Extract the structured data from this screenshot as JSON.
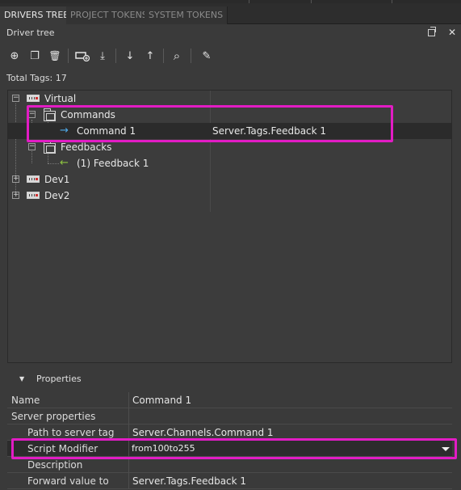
{
  "tabs": [
    {
      "label": "DRIVERS TREE",
      "active": true
    },
    {
      "label": "PROJECT TOKENS",
      "active": false
    },
    {
      "label": "SYSTEM TOKENS",
      "active": false
    }
  ],
  "panel": {
    "title": "Driver tree",
    "pin_icon": "pin-icon",
    "close_glyph": "✕"
  },
  "toolbar": {
    "icons": [
      "add-circle-icon",
      "copy-icon",
      "delete-icon",
      "add-device-icon",
      "import-icon",
      "move-down-icon",
      "move-up-icon",
      "search-icon",
      "clean-icon"
    ],
    "glyphs": {
      "add": "⊕",
      "copy": "❐",
      "delete": "🗑",
      "device": "▭",
      "import": "⤓",
      "down": "↓",
      "up": "↑",
      "search": "⌕",
      "clean": "✎"
    }
  },
  "total_tags": "Total Tags: 17",
  "tree": {
    "rows": [
      {
        "label": "Virtual",
        "value": "",
        "expander": "−"
      },
      {
        "label": "Commands",
        "value": "",
        "expander": "−"
      },
      {
        "label": "Command 1",
        "value": "Server.Tags.Feedback 1",
        "arrow": "→"
      },
      {
        "label": "Feedbacks",
        "value": "",
        "expander": "−"
      },
      {
        "label": "(1) Feedback 1",
        "value": "",
        "arrow": "←"
      },
      {
        "label": "Dev1",
        "value": "",
        "expander": "+"
      },
      {
        "label": "Dev2",
        "value": "",
        "expander": "+"
      }
    ]
  },
  "properties": {
    "header": "Properties",
    "chevron": "▼",
    "rows": [
      {
        "name": "Name",
        "value": "Command 1"
      },
      {
        "name": "Server properties",
        "value": ""
      },
      {
        "name": "Path to server tag",
        "value": "Server.Channels.Command 1"
      },
      {
        "name": "Script Modifier",
        "value": "from100to255"
      },
      {
        "name": "Description",
        "value": ""
      },
      {
        "name": "Forward value to",
        "value": "Server.Tags.Feedback 1"
      }
    ]
  },
  "colors": {
    "highlight": "#e21cc4",
    "arrow_out": "#4fa9e8",
    "arrow_in": "#8ec441",
    "background": "#3a3a3a"
  }
}
